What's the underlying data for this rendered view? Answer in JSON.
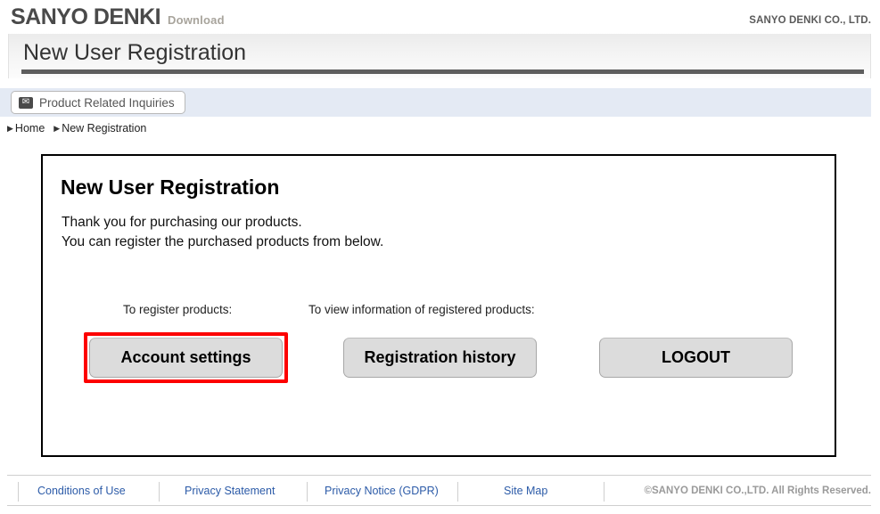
{
  "header": {
    "logo": "SANYO DENKI",
    "download_label": "Download",
    "corporate_name": "SANYO DENKI CO., LTD."
  },
  "page_title": "New User Registration",
  "inquiry_bar": {
    "button_label": "Product Related Inquiries",
    "mail_icon": "envelope-icon",
    "background_color": "#e4eaf4"
  },
  "breadcrumb": {
    "arrow": "▶",
    "items": [
      {
        "label": "Home"
      },
      {
        "label": "New Registration"
      }
    ]
  },
  "card": {
    "heading": "New User Registration",
    "line1": "Thank you for purchasing our products.",
    "line2": "You can register the purchased products from below."
  },
  "actions": {
    "register_label": "To register products:",
    "view_label": "To view information of registered products:",
    "buttons": [
      {
        "label": "Account settings",
        "highlighted": true,
        "highlight_color": "#fd0000"
      },
      {
        "label": "Registration history",
        "highlighted": false
      },
      {
        "label": "LOGOUT",
        "highlighted": false
      }
    ]
  },
  "footer": {
    "links": [
      {
        "label": "Conditions of Use"
      },
      {
        "label": "Privacy Statement"
      },
      {
        "label": "Privacy Notice (GDPR)"
      },
      {
        "label": "Site Map"
      }
    ],
    "copyright": "©SANYO DENKI CO.,LTD. All Rights Reserved.",
    "link_color": "#2c5ba8"
  }
}
